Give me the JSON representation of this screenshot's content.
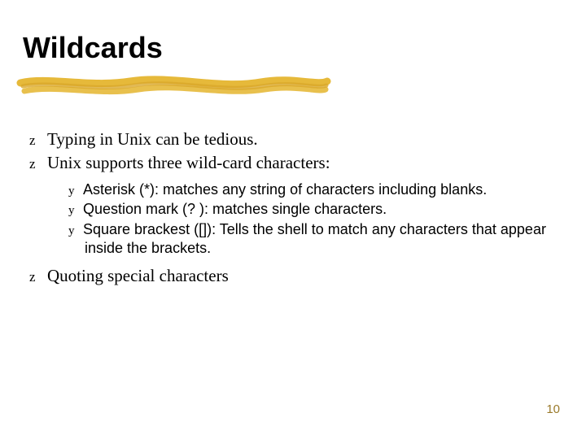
{
  "title": "Wildcards",
  "bullets": {
    "b1": "Typing in Unix can be tedious.",
    "b2": "Unix supports three wild-card characters:",
    "b2_1": "Asterisk (*): matches any string of characters including blanks.",
    "b2_2": "Question mark (? ): matches single characters.",
    "b2_3": "Square brackest ([]): Tells the shell to match any characters that appear inside the brackets.",
    "b3": "Quoting special characters"
  },
  "glyphs": {
    "z": "z",
    "y": "y"
  },
  "page_number": "10"
}
